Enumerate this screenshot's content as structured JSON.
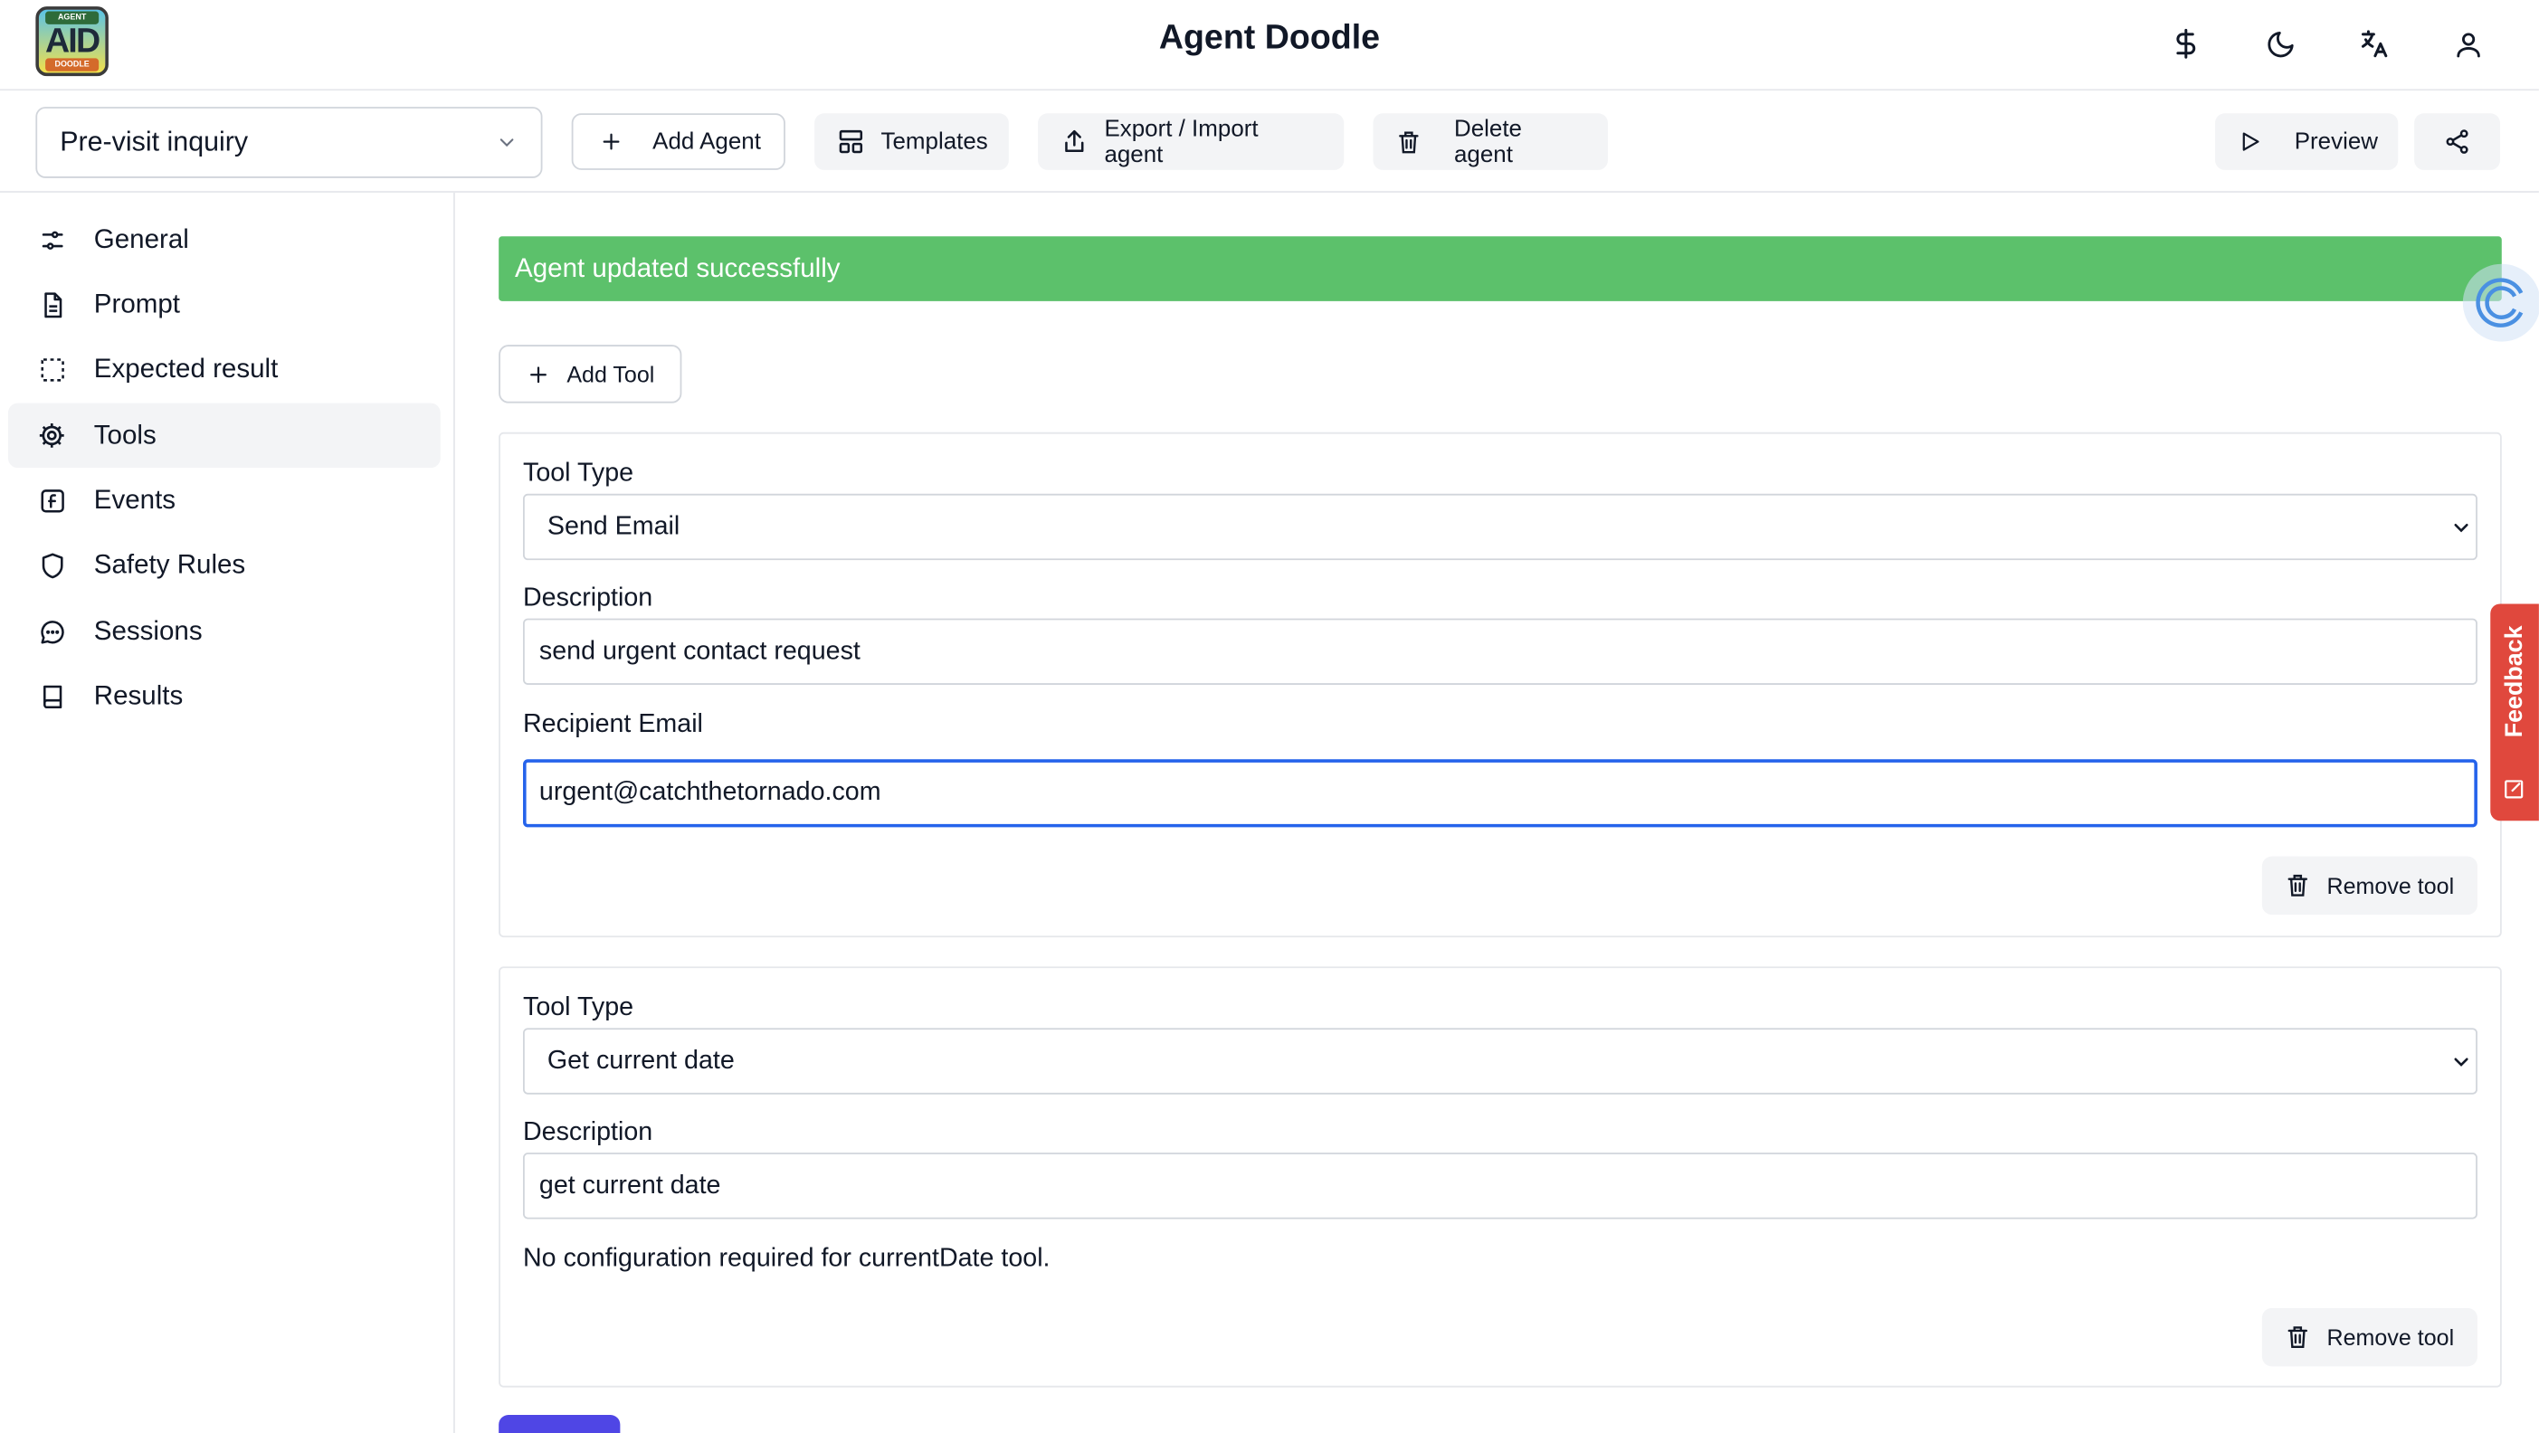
{
  "app": {
    "title": "Agent Doodle",
    "logo": {
      "top": "AGENT",
      "main": "AID",
      "bottom": "DOODLE"
    }
  },
  "header_icons": [
    "dollar-icon",
    "moon-icon",
    "translate-icon",
    "user-icon"
  ],
  "toolbar": {
    "agent_selected": "Pre-visit inquiry",
    "add_agent": "Add Agent",
    "templates": "Templates",
    "export_import": "Export / Import agent",
    "delete_agent": "Delete agent",
    "preview": "Preview"
  },
  "sidebar": {
    "items": [
      {
        "label": "General",
        "icon": "sliders-icon"
      },
      {
        "label": "Prompt",
        "icon": "document-icon"
      },
      {
        "label": "Expected result",
        "icon": "dashed-square-icon"
      },
      {
        "label": "Tools",
        "icon": "gear-icon",
        "active": true
      },
      {
        "label": "Events",
        "icon": "function-icon"
      },
      {
        "label": "Safety Rules",
        "icon": "shield-icon"
      },
      {
        "label": "Sessions",
        "icon": "chat-icon"
      },
      {
        "label": "Results",
        "icon": "book-icon"
      }
    ]
  },
  "main": {
    "success_message": "Agent updated successfully",
    "add_tool": "Add Tool",
    "tools": [
      {
        "tool_type_label": "Tool Type",
        "tool_type": "Send Email",
        "description_label": "Description",
        "description": "send urgent contact request",
        "recipient_label": "Recipient Email",
        "recipient": "urgent@catchthetornado.com",
        "remove": "Remove tool"
      },
      {
        "tool_type_label": "Tool Type",
        "tool_type": "Get current date",
        "description_label": "Description",
        "description": "get current date",
        "note": "No configuration required for currentDate tool.",
        "remove": "Remove tool"
      }
    ]
  },
  "feedback": {
    "label": "Feedback"
  },
  "colors": {
    "success": "#5cc16b",
    "primary": "#4f46e5",
    "focus": "#2563eb",
    "feedback": "#e0483d"
  }
}
